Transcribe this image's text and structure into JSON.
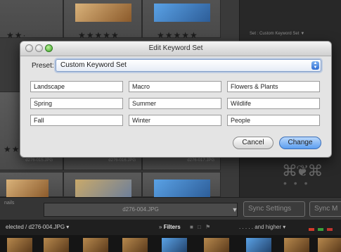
{
  "dialog": {
    "title": "Edit Keyword Set",
    "preset_label": "Preset:",
    "preset_value": "Custom Keyword Set",
    "keywords": [
      "Landscape",
      "Macro",
      "Flowers & Plants",
      "Spring",
      "Summer",
      "Wildlife",
      "Fall",
      "Winter",
      "People"
    ],
    "cancel_label": "Cancel",
    "change_label": "Change"
  },
  "background": {
    "right_panel_set_label": "Set : Custom Keyword Set",
    "right_panel_chevron": "▼",
    "filenames": [
      "d276-015.JPG",
      "d276-016.JPG",
      "d276-017.JPG"
    ],
    "thumbnails_label": "nails",
    "current_filename": "d276-004.JPG",
    "sync_settings_label": "Sync Settings",
    "sync_metadata_label": "Sync M",
    "selected_text": "elected / d276-004.JPG ▾",
    "filters_prefix": "»",
    "filters_label": "Filters",
    "and_higher_label": ". . . . . and higher ▾",
    "stars": "★★★★★",
    "stars_partial": "★★·",
    "filter_colors": [
      "#d23a2a",
      "#3aa03a",
      "#c0342e"
    ]
  }
}
